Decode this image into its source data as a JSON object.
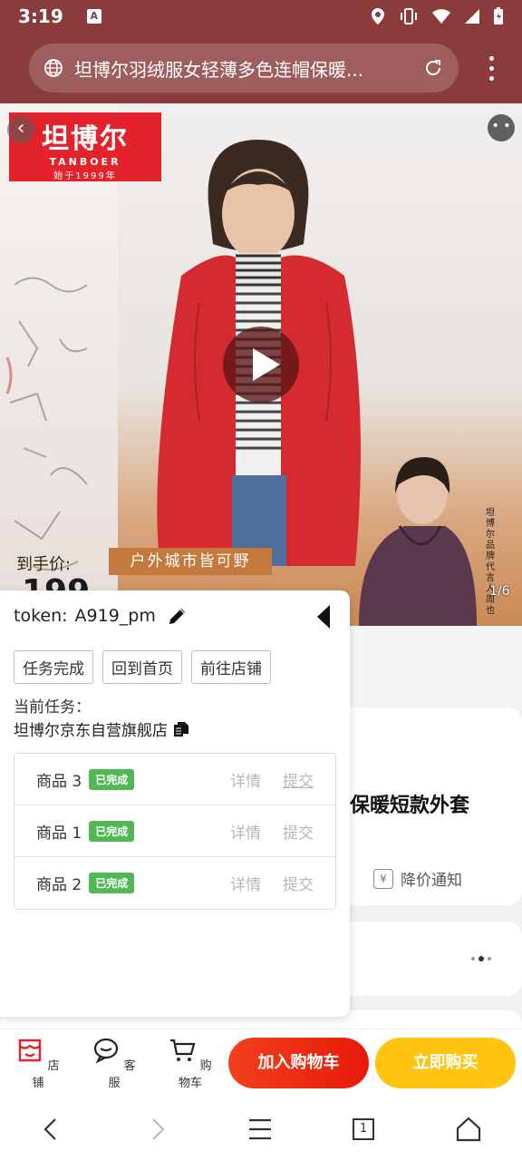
{
  "status_bar": {
    "time": "3:19",
    "a_icon": "A"
  },
  "url_bar": {
    "title": "坦博尔羽绒服女轻薄多色连帽保暖..."
  },
  "hero": {
    "brand_name": "坦博尔",
    "brand_en": "TANBOER",
    "brand_since": "始于1999年",
    "tag_banner": "户外城市皆可野",
    "price_label": "到手价:",
    "price_value": "199",
    "ambassador_note": "坦博尔品牌代言人 周也",
    "slide_index": "1/6"
  },
  "panel": {
    "token_label": "token:",
    "token_value": "A919_pm",
    "buttons": [
      "任务完成",
      "回到首页",
      "前往店铺"
    ],
    "current_task_label": "当前任务：",
    "store_name": "坦博尔京东自营旗舰店",
    "tasks": [
      {
        "name": "商品 3",
        "status": "已完成",
        "detail": "详情",
        "submit": "提交"
      },
      {
        "name": "商品 1",
        "status": "已完成",
        "detail": "详情",
        "submit": "提交"
      },
      {
        "name": "商品 2",
        "status": "已完成",
        "detail": "详情",
        "submit": "提交"
      }
    ]
  },
  "product": {
    "title_tail": "保暖短款外套",
    "price_alert": "降价通知"
  },
  "action_bar": {
    "shop": "店铺",
    "service": "客服",
    "cart": "购物车",
    "add_to_cart": "加入购物车",
    "buy_now": "立即购买"
  },
  "nav_bar": {
    "tab_count": "1"
  },
  "colors": {
    "accent_red": "#e3222b",
    "done_green": "#52b856",
    "buy_yellow": "#ffc412",
    "browser_chrome": "#8a3b3b"
  }
}
